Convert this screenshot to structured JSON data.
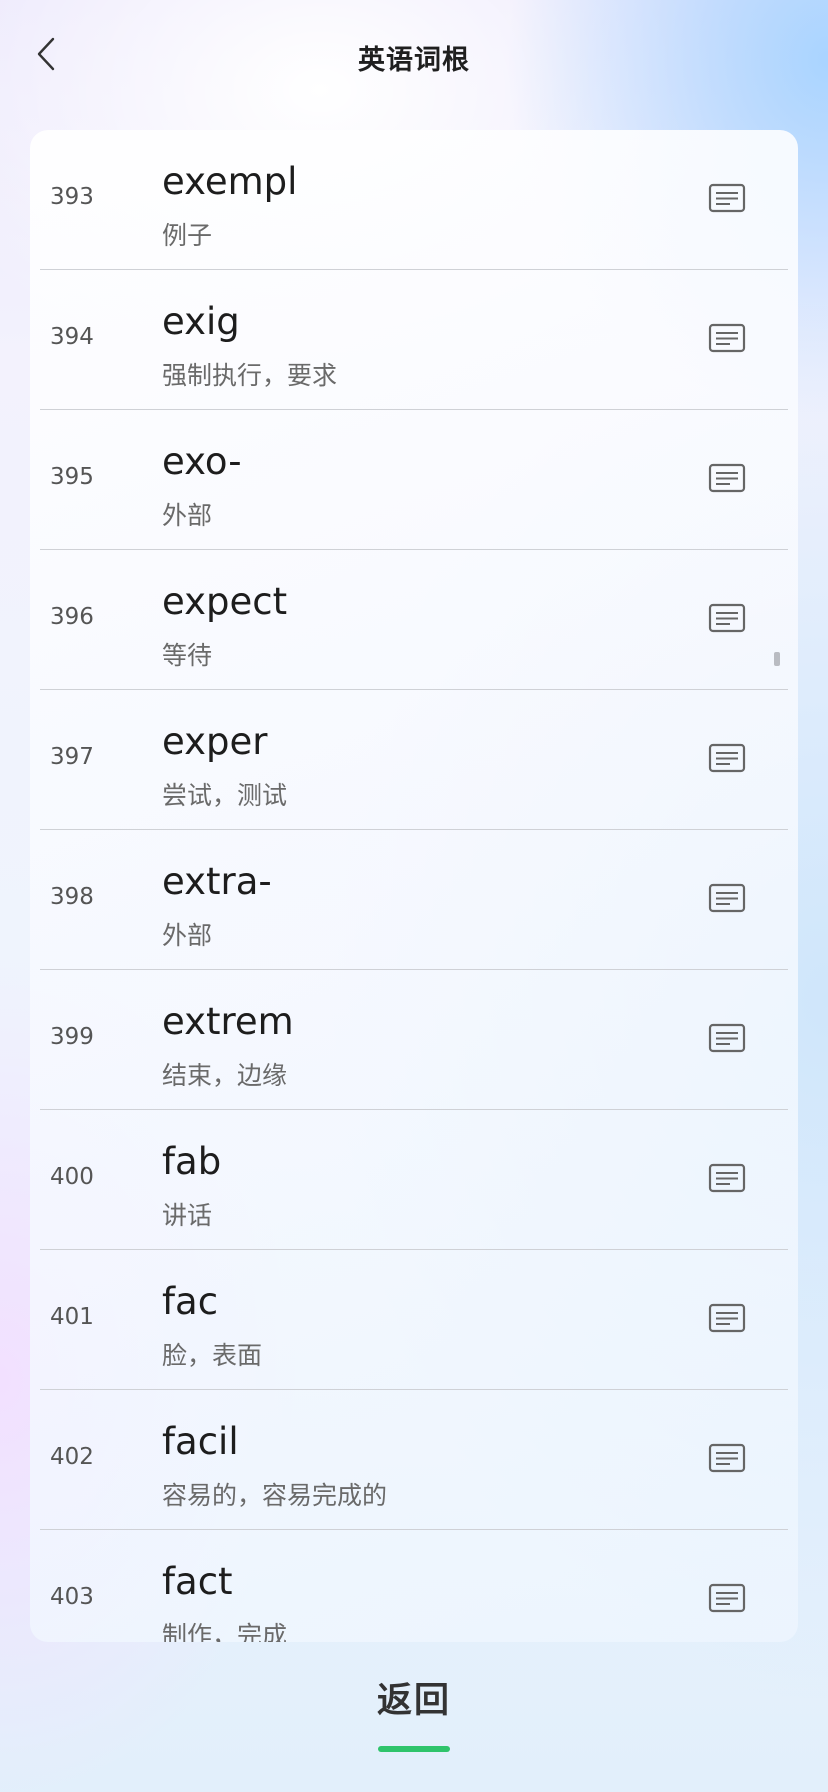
{
  "header": {
    "title": "英语词根",
    "back_icon": "chevron-left-icon"
  },
  "list": {
    "item_icon": "document-lines-icon",
    "items": [
      {
        "num": "393",
        "word": "exempl",
        "meaning": "例子"
      },
      {
        "num": "394",
        "word": "exig",
        "meaning": "强制执行，要求"
      },
      {
        "num": "395",
        "word": "exo-",
        "meaning": "外部"
      },
      {
        "num": "396",
        "word": "expect",
        "meaning": "等待"
      },
      {
        "num": "397",
        "word": "exper",
        "meaning": "尝试，测试"
      },
      {
        "num": "398",
        "word": "extra-",
        "meaning": "外部"
      },
      {
        "num": "399",
        "word": "extrem",
        "meaning": "结束，边缘"
      },
      {
        "num": "400",
        "word": "fab",
        "meaning": "讲话"
      },
      {
        "num": "401",
        "word": "fac",
        "meaning": "脸，表面"
      },
      {
        "num": "402",
        "word": "facil",
        "meaning": "容易的，容易完成的"
      },
      {
        "num": "403",
        "word": "fact",
        "meaning": "制作，完成"
      }
    ]
  },
  "footer": {
    "return_label": "返回",
    "accent_color": "#2fc46b"
  }
}
